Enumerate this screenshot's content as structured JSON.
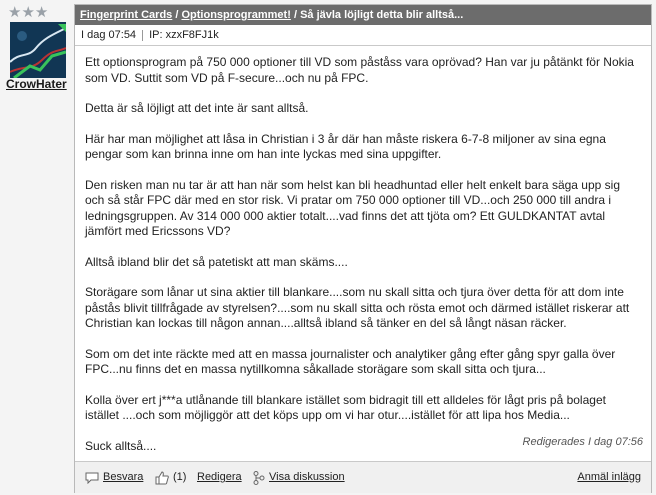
{
  "user": {
    "username": "CrowHater",
    "stars": "★★★"
  },
  "post": {
    "breadcrumb": {
      "company": "Fingerprint Cards",
      "separator1": "/",
      "forum": "Optionsprogrammet!",
      "separator2": "/",
      "title": "Så jävla löjligt detta blir alltså..."
    },
    "meta": {
      "date": "I dag 07:54",
      "ip": "IP: xzxF8FJ1k"
    },
    "paragraphs": [
      "Ett optionsprogram på 750 000 optioner till VD som påståss vara oprövad? Han var ju påtänkt för Nokia som VD. Suttit som VD på F-secure...och nu på FPC.",
      "Detta är så löjligt att det inte är sant alltså.",
      "Här har man möjlighet att låsa in Christian i 3 år där han måste riskera 6-7-8 miljoner av sina egna pengar som kan brinna inne om han inte lyckas med sina uppgifter.",
      "Den risken man nu tar är att han när som helst kan bli headhuntad eller helt enkelt bara säga upp sig och så står FPC där med en stor risk. Vi pratar om 750 000 optioner till VD...och 250 000 till andra i ledningsgruppen. Av 314 000 000 aktier totalt....vad finns det att tjöta om? Ett GULDKANTAT avtal jämfört med Ericssons VD?",
      "Alltså ibland blir det så patetiskt att man skäms....",
      "Storägare som lånar ut sina aktier till blankare....som nu skall sitta och tjura över detta för att dom inte påstås blivit tillfrågade av styrelsen?....som nu skall sitta och rösta emot och därmed istället riskerar att Christian kan lockas till någon annan....alltså ibland så tänker en del så långt näsan räcker.",
      "Som om det inte räckte med att en massa journalister och analytiker gång efter gång spyr galla över FPC...nu finns det en massa nytillkomna såkallade storägare som skall sitta och tjura...",
      "Kolla över ert j***a utlånande till blankare istället som bidragit till ett alldeles för lågt pris på bolaget istället ....och som möjliggör att det köps upp om vi har otur....istället för att lipa hos Media...",
      "Suck alltså...."
    ],
    "edited": "Redigerades I dag 07:56",
    "actions": {
      "reply": "Besvara",
      "likes": "(1)",
      "edit": "Redigera",
      "show_discussion": "Visa diskussion",
      "report": "Anmäl inlägg"
    }
  }
}
